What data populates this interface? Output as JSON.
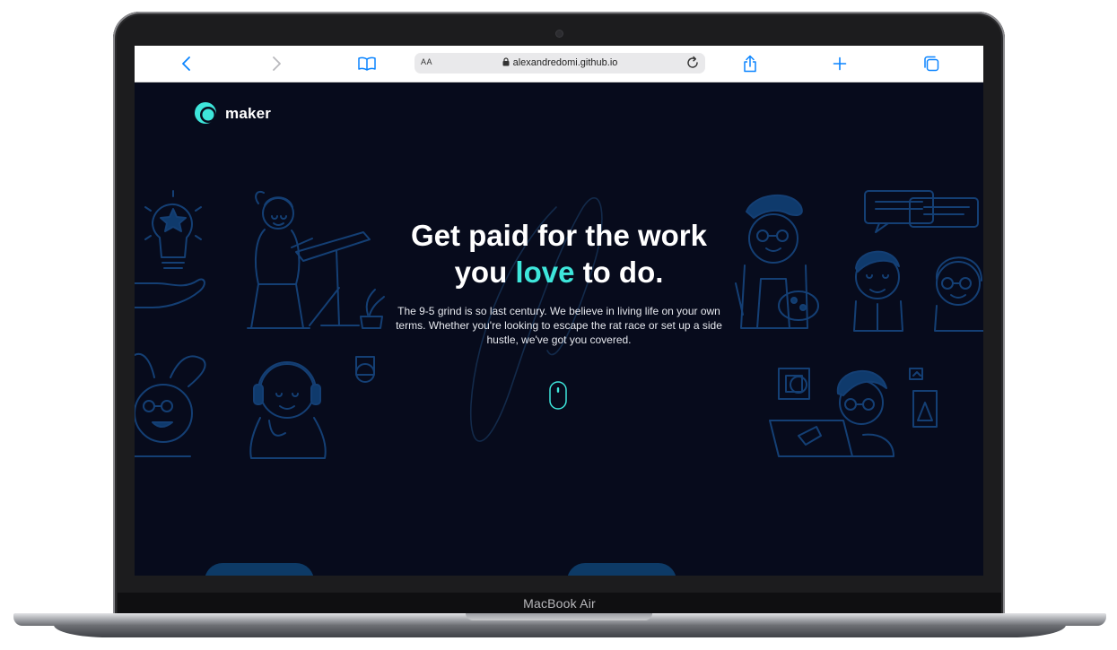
{
  "device": {
    "label": "MacBook Air"
  },
  "browser": {
    "reader_label": "AA",
    "url": "alexandredomi.github.io",
    "accent_color": "#0a84ff"
  },
  "site": {
    "logo_text": "maker",
    "headline_part1": "Get paid for the work",
    "headline_part2": "you ",
    "headline_accent": "love",
    "headline_part3": " to do.",
    "description": "The 9-5 grind is so last century. We believe in living life on your own terms. Whether you're looking to escape the rat race or set up a side hustle, we've got you covered.",
    "accent_color": "#3ee6db",
    "background_color": "#070b1c"
  },
  "icons": [
    "back-icon",
    "forward-icon",
    "bookmarks-icon",
    "lock-icon",
    "reload-icon",
    "share-icon",
    "new-tab-icon",
    "tabs-icon",
    "scroll-mouse-icon"
  ]
}
